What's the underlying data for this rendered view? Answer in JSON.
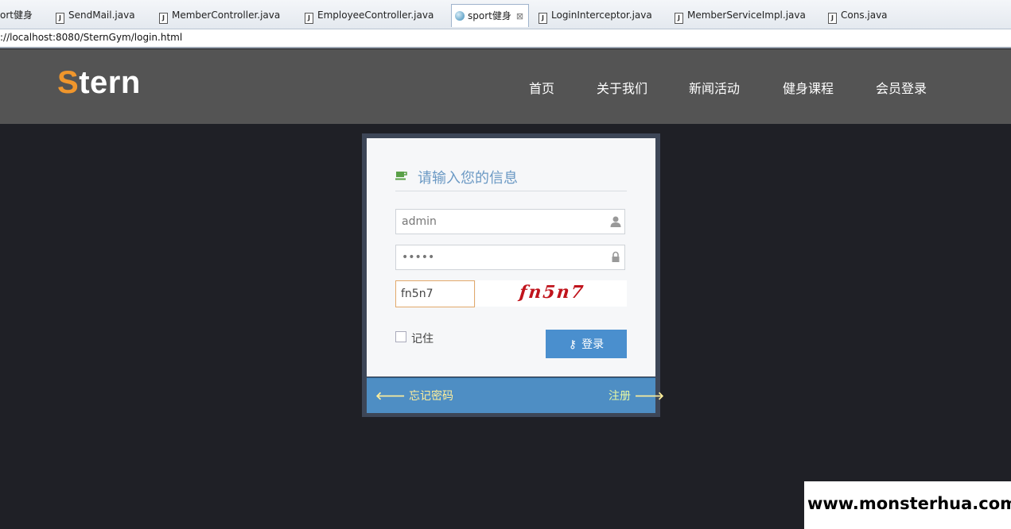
{
  "ide": {
    "tabs": [
      {
        "label": "ort健身",
        "type": "web"
      },
      {
        "label": "SendMail.java",
        "type": "java"
      },
      {
        "label": "MemberController.java",
        "type": "java"
      },
      {
        "label": "EmployeeController.java",
        "type": "java"
      },
      {
        "label": "sport健身",
        "type": "web",
        "active": true
      },
      {
        "label": "LoginInterceptor.java",
        "type": "java"
      },
      {
        "label": "MemberServiceImpl.java",
        "type": "java"
      },
      {
        "label": "Cons.java",
        "type": "java"
      }
    ],
    "address": "://localhost:8080/SternGym/login.html"
  },
  "site": {
    "logo_initial": "S",
    "logo_rest": "tern",
    "nav": [
      "首页",
      "关于我们",
      "新闻活动",
      "健身课程",
      "会员登录"
    ]
  },
  "login": {
    "heading": "请输入您的信息",
    "username_value": "admin",
    "password_value": "•••••",
    "captcha_value": "fn5n7",
    "captcha_image_text": "fn5n7",
    "remember_label": "记住",
    "login_button": "登录",
    "forgot_password": "忘记密码",
    "register": "注册"
  },
  "watermark": "www.monsterhua.com",
  "colors": {
    "logo_accent": "#f0962c",
    "header_bg": "#545454",
    "page_bg": "#1f2026",
    "heading_text": "#6b99c4",
    "button_bg": "#4a8fce",
    "footer_bg": "#4e8ec4",
    "captcha_text": "#c0141c",
    "captcha_border": "#e2a96b"
  }
}
